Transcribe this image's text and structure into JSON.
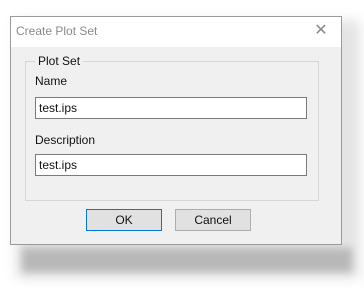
{
  "dialog": {
    "title": "Create Plot Set",
    "close_glyph": "✕",
    "close_icon": "close-icon"
  },
  "group": {
    "legend": "Plot Set",
    "name_label": "Name",
    "name_value": "test.ips",
    "description_label": "Description",
    "description_value": "test.ips"
  },
  "buttons": {
    "ok_label": "OK",
    "cancel_label": "Cancel"
  },
  "colors": {
    "dialog_background": "#f0f0f0",
    "titlebar_background": "#ffffff",
    "default_button_border": "#0078d7"
  }
}
